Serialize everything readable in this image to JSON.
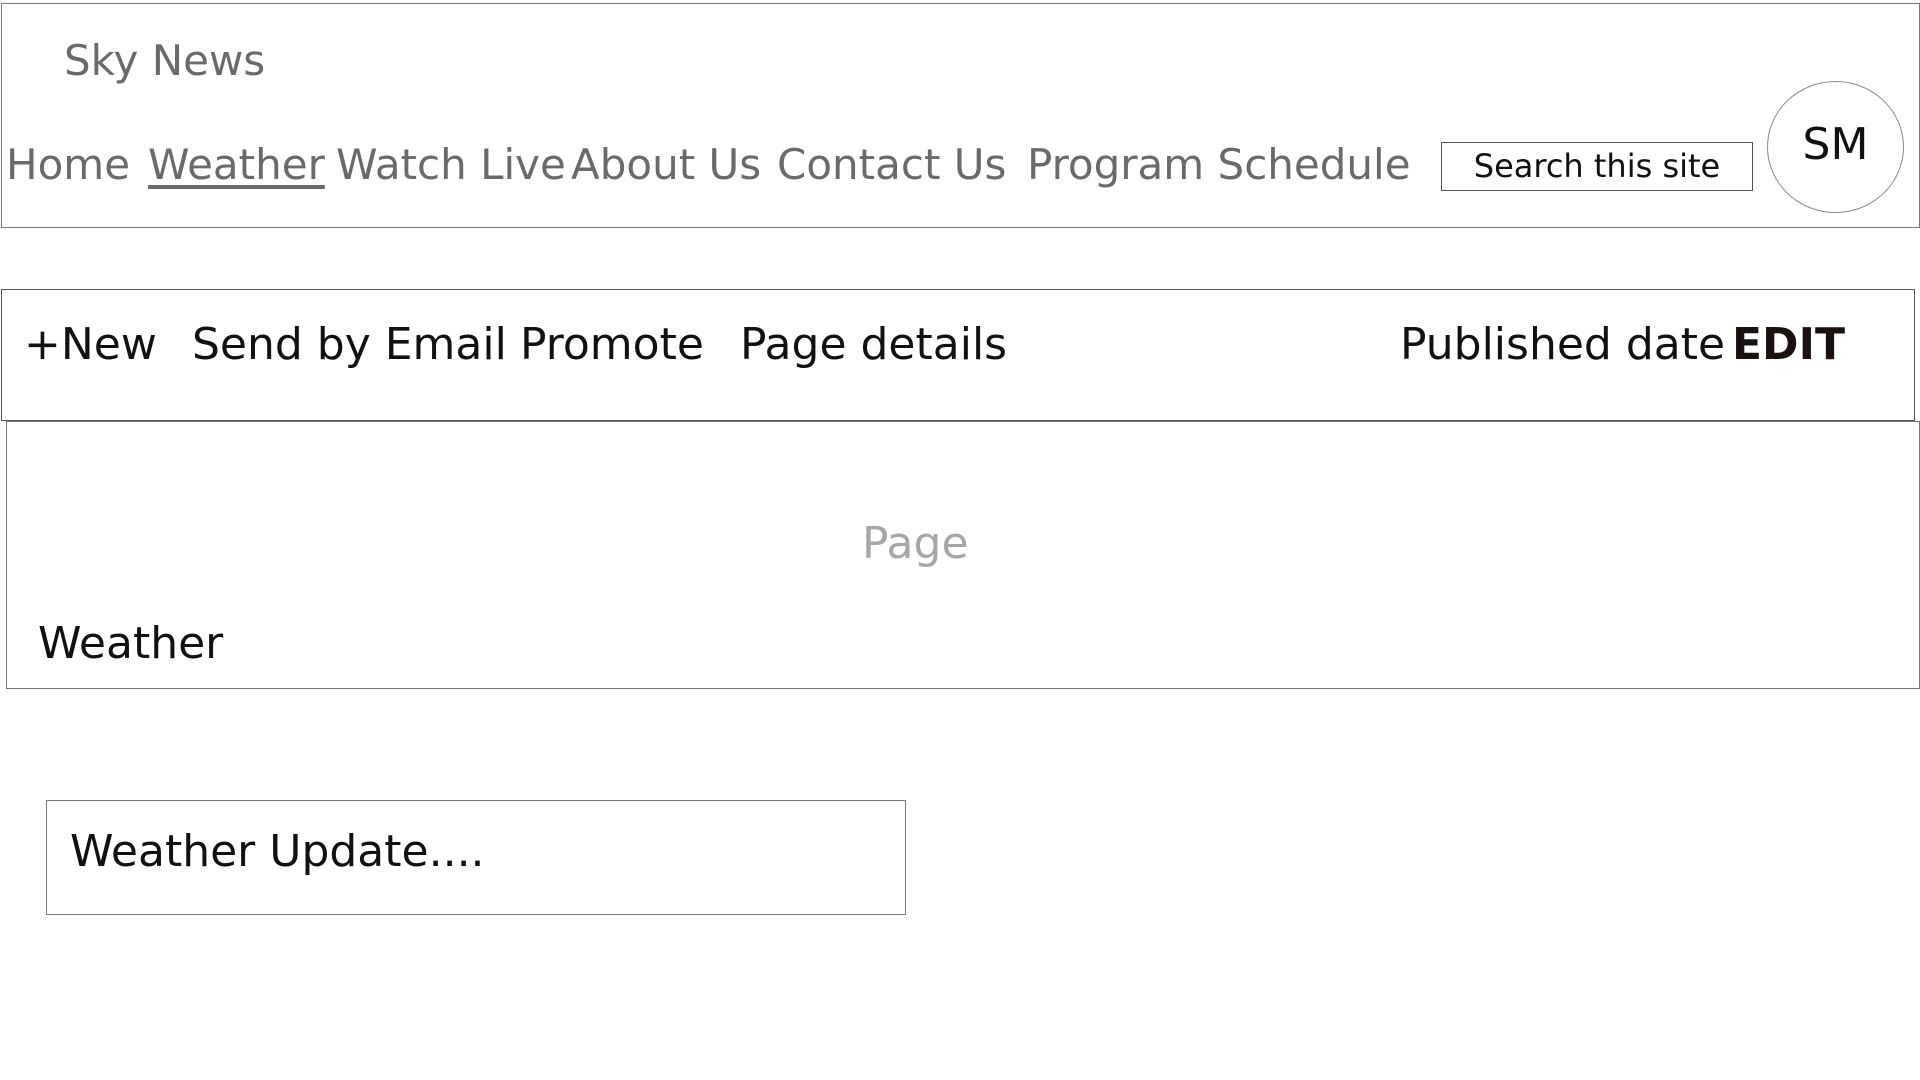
{
  "site": {
    "title": "Sky News"
  },
  "nav": {
    "items": [
      {
        "label": "Home",
        "active": false
      },
      {
        "label": "Weather",
        "active": true
      },
      {
        "label": "Watch Live",
        "active": false
      },
      {
        "label": "About Us",
        "active": false
      },
      {
        "label": "Contact Us",
        "active": false
      },
      {
        "label": "Program Schedule",
        "active": false
      }
    ]
  },
  "search": {
    "placeholder": "Search this site"
  },
  "user": {
    "initials": "SM"
  },
  "toolbar": {
    "new_label": "+New",
    "email_label": "Send by Email",
    "promote_label": "Promote",
    "details_label": "Page details",
    "published_label": "Published date",
    "edit_label": "EDIT"
  },
  "page": {
    "type_label": "Page",
    "title": "Weather"
  },
  "content": {
    "text": "Weather Update...."
  }
}
